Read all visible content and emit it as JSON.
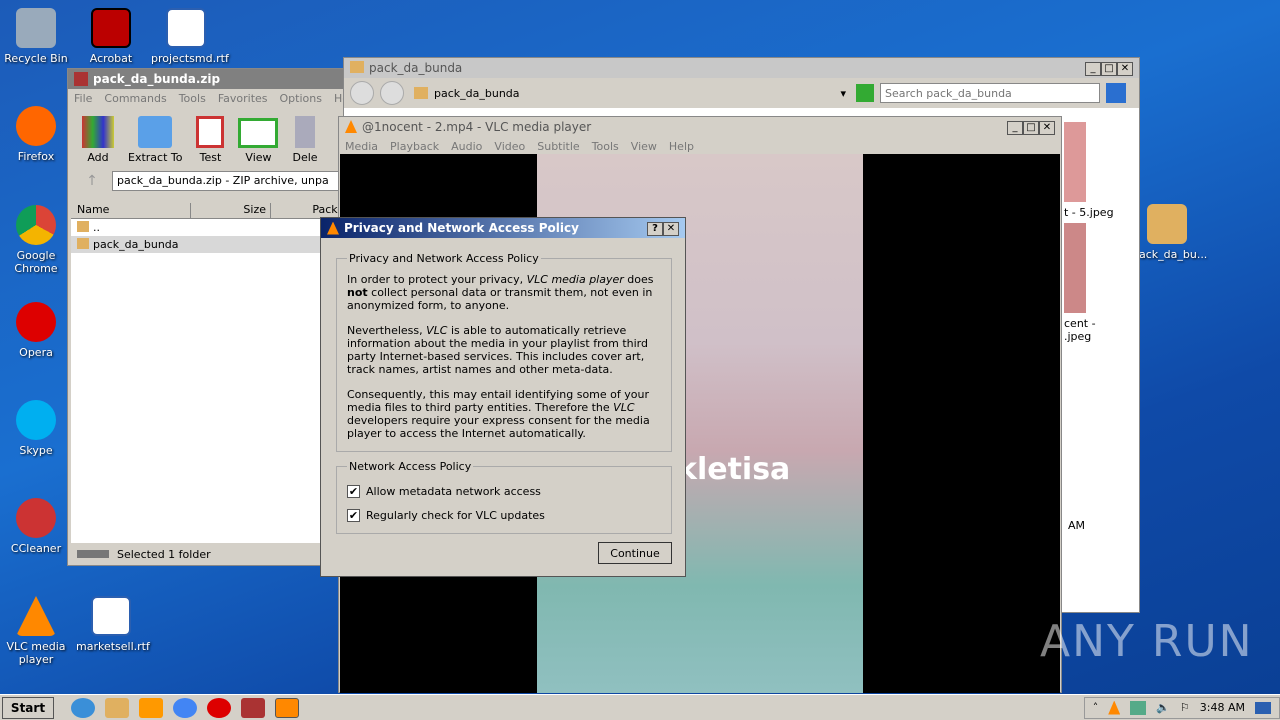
{
  "desktop": {
    "icons": [
      {
        "label": "Recycle Bin",
        "color": "#9ab"
      },
      {
        "label": "Acrobat",
        "color": "#b00"
      },
      {
        "label": "projectsmd.rtf",
        "color": "#2b5fb0"
      },
      {
        "label": "Firefox",
        "color": "#f60"
      },
      {
        "label": "Google Chrome",
        "color": "#4285f4"
      },
      {
        "label": "Opera",
        "color": "#d00"
      },
      {
        "label": "Skype",
        "color": "#00aff0"
      },
      {
        "label": "CCleaner",
        "color": "#c33"
      },
      {
        "label": "VLC media player",
        "color": "#f80"
      },
      {
        "label": "marketsell.rtf",
        "color": "#2b5fb0"
      },
      {
        "label": "pack_da_bu...",
        "color": "#e0b060"
      }
    ]
  },
  "winrar": {
    "title": "pack_da_bunda.zip",
    "menu": [
      "File",
      "Commands",
      "Tools",
      "Favorites",
      "Options",
      "Help"
    ],
    "toolbar": [
      "Add",
      "Extract To",
      "Test",
      "View",
      "Dele"
    ],
    "path": "pack_da_bunda.zip - ZIP archive, unpa",
    "columns": [
      "Name",
      "Size",
      "Packe"
    ],
    "rows": [
      "..",
      "pack_da_bunda"
    ],
    "status": "Selected 1 folder"
  },
  "explorer": {
    "title": "pack_da_bunda",
    "address": "pack_da_bunda",
    "search_placeholder": "Search pack_da_bunda",
    "files": [
      "t - 5.jpeg",
      "cent -\n.jpeg"
    ],
    "time_fragment": "AM"
  },
  "vlc": {
    "title": "@1nocent - 2.mp4 - VLC media player",
    "menu": [
      "Media",
      "Playback",
      "Audio",
      "Video",
      "Subtitle",
      "Tools",
      "View",
      "Help"
    ],
    "overlay_text": "kletisa"
  },
  "dialog": {
    "title": "Privacy and Network Access Policy",
    "group1": "Privacy and Network Access Policy",
    "p1a": "In order to protect your privacy, ",
    "p1b": "VLC media player",
    "p1c": " does ",
    "p1d": "not",
    "p1e": " collect personal data or transmit them, not even in anonymized form, to anyone.",
    "p2a": "Nevertheless, ",
    "p2b": "VLC",
    "p2c": " is able to automatically retrieve information about the media in your playlist from third party Internet-based services. This includes cover art, track names, artist names and other meta-data.",
    "p3a": "Consequently, this may entail identifying some of your media files to third party entities. Therefore the ",
    "p3b": "VLC",
    "p3c": " developers require your express consent for the media player to access the Internet automatically.",
    "group2": "Network Access Policy",
    "check1": {
      "label": "Allow metadata network access",
      "checked": true
    },
    "check2": {
      "label": "Regularly check for VLC updates",
      "checked": true
    },
    "continue": "Continue"
  },
  "taskbar": {
    "start": "Start",
    "clock": "3:48 AM"
  },
  "watermark": "ANY RUN"
}
